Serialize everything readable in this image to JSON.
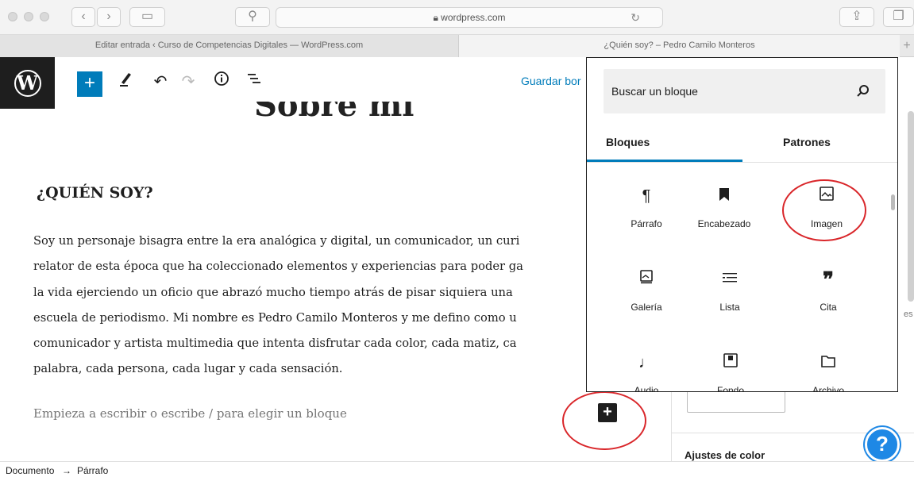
{
  "browser": {
    "url": "wordpress.com",
    "tabs": [
      {
        "label": "Editar entrada ‹ Curso de Competencias Digitales — WordPress.com"
      },
      {
        "label": "¿Quién soy? – Pedro Camilo Monteros"
      }
    ]
  },
  "toolbar": {
    "save_draft_label": "Guardar bor"
  },
  "post": {
    "title_partial": "Sobre mi",
    "heading": "¿QUIÉN SOY?",
    "paragraph_lines": [
      "Soy un personaje bisagra entre la era analógica y digital, un comunicador, un curi",
      "relator de esta época que ha coleccionado elementos y experiencias para poder ga",
      "la vida ejerciendo un oficio que abrazó mucho tiempo atrás de pisar siquiera una",
      "escuela de periodismo. Mi nombre es Pedro Camilo Monteros y me defino como u",
      "comunicador y artista multimedia que intenta disfrutar cada color, cada matiz, ca",
      "palabra, cada persona, cada lugar  y cada sensación."
    ],
    "empty_block_placeholder": "Empieza a escribir o escribe / para elegir un bloque"
  },
  "inserter": {
    "search_placeholder": "Buscar un bloque",
    "tabs": [
      {
        "label": "Bloques",
        "active": true
      },
      {
        "label": "Patrones",
        "active": false
      }
    ],
    "blocks": [
      {
        "label": "Párrafo",
        "icon": "paragraph-icon"
      },
      {
        "label": "Encabezado",
        "icon": "bookmark-icon"
      },
      {
        "label": "Imagen",
        "icon": "image-icon"
      },
      {
        "label": "Galería",
        "icon": "gallery-icon"
      },
      {
        "label": "Lista",
        "icon": "list-icon"
      },
      {
        "label": "Cita",
        "icon": "quote-icon"
      },
      {
        "label": "Audio",
        "icon": "audio-icon"
      },
      {
        "label": "Fondo",
        "icon": "cover-icon"
      },
      {
        "label": "Archivo",
        "icon": "file-icon"
      }
    ]
  },
  "sidebar": {
    "color_settings_heading": "Ajustes de color",
    "cut_text": "es"
  },
  "breadcrumb": {
    "items": [
      "Documento",
      "Párrafo"
    ],
    "separator": "→"
  },
  "colors": {
    "accent": "#007cba",
    "annotation": "#d9262a",
    "help": "#1e88e5"
  }
}
